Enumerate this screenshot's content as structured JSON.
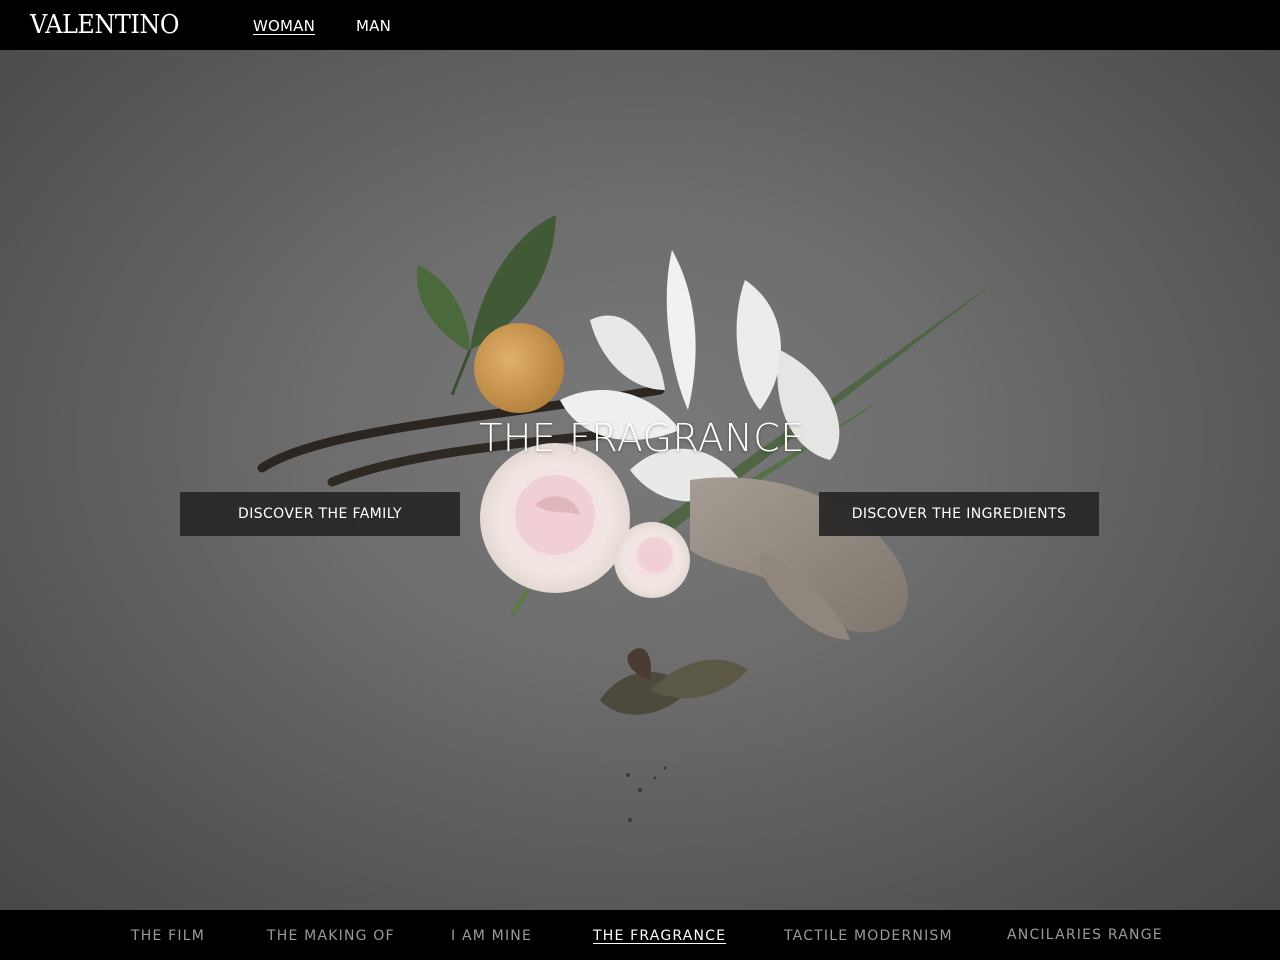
{
  "header": {
    "logo": "VALENTINO",
    "nav": [
      {
        "label": "WOMAN",
        "active": true
      },
      {
        "label": "MAN",
        "active": false
      }
    ]
  },
  "hero": {
    "title": "THE FRAGRANCE",
    "cta_left": "DISCOVER THE FAMILY",
    "cta_right": "DISCOVER THE INGREDIENTS"
  },
  "footer_nav": [
    {
      "label": "THE FILM",
      "active": false
    },
    {
      "label": "THE MAKING OF",
      "active": false
    },
    {
      "label": "I AM MINE",
      "active": false
    },
    {
      "label": "THE FRAGRANCE",
      "active": true
    },
    {
      "label": "TACTILE MODERNISM",
      "active": false
    },
    {
      "label": "ANCILARIES RANGE",
      "active": false
    }
  ],
  "colors": {
    "bar_background": "#000000",
    "hero_background": "#6d6d6d",
    "cta_background": "#262626",
    "inactive_text": "#9a9a9a",
    "active_text": "#ffffff"
  }
}
